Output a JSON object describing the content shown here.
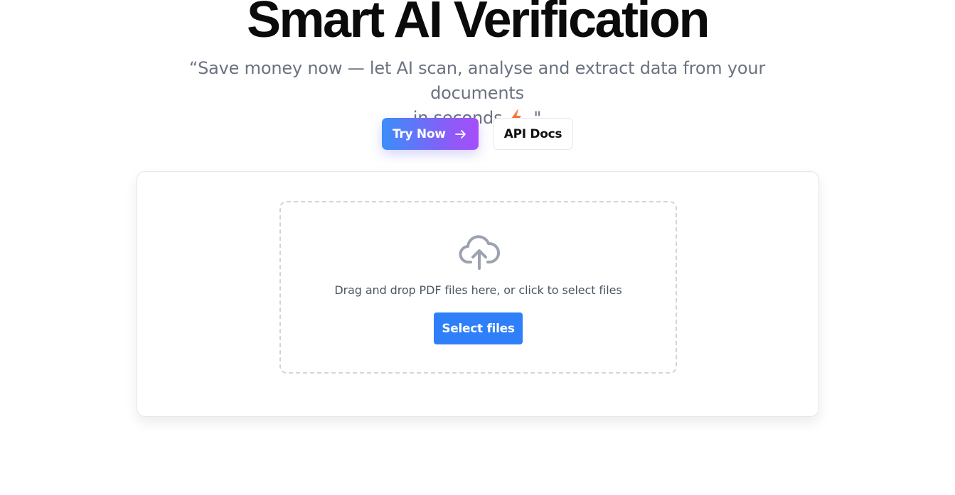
{
  "hero": {
    "title": "Smart AI Verification",
    "subtitle_line1": "“Save money now — let AI scan, analyse and extract data from your documents",
    "subtitle_line2_start": "in seconds",
    "subtitle_line2_end": "\"",
    "subtitle_icon": "lightning-bolt-icon"
  },
  "actions": {
    "try_now_label": "Try Now",
    "try_now_icon": "arrow-right-icon",
    "api_docs_label": "API Docs"
  },
  "upload": {
    "icon": "cloud-upload-icon",
    "instruction": "Drag and drop PDF files here, or click to select files",
    "select_files_label": "Select files"
  },
  "colors": {
    "gradient_start": "#3b8df9",
    "gradient_end": "#a64dfb",
    "primary_blue": "#2e7ff9",
    "bolt_orange": "#f97316"
  }
}
